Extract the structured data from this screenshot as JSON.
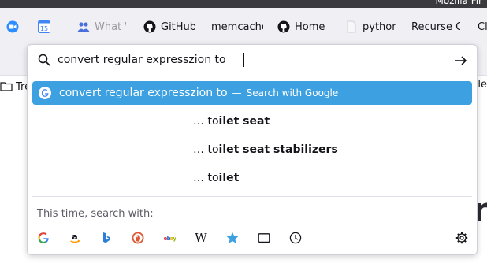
{
  "window": {
    "title_fragment": "Mozilla Fir"
  },
  "bookmarks": {
    "items": [
      {
        "label": "",
        "icon": "zoom-icon"
      },
      {
        "label": "",
        "icon": "calendar-icon",
        "badge": "15"
      },
      {
        "label": "What W",
        "icon": "people-icon"
      },
      {
        "label": "GitHub",
        "icon": "github-icon"
      },
      {
        "label": "memcache",
        "icon": ""
      },
      {
        "label": "Home",
        "icon": "github-icon"
      },
      {
        "label": "python",
        "icon": "page-icon"
      },
      {
        "label": "Recurse C",
        "icon": ""
      },
      {
        "label": "Cl",
        "icon": ""
      }
    ],
    "folder_label": "Tre",
    "right_fragment": "ble"
  },
  "urlbar": {
    "value": "convert regular expresszion to ",
    "go_icon": "arrow-right-icon"
  },
  "results": {
    "selected": {
      "query": "convert regular expresszion to",
      "separator": "—",
      "action": "Search with Google"
    },
    "suggestions": [
      {
        "prefix": "… to",
        "completion": "ilet seat"
      },
      {
        "prefix": "… to",
        "completion": "ilet seat stabilizers"
      },
      {
        "prefix": "… to",
        "completion": "ilet"
      }
    ]
  },
  "oneoffs": {
    "label": "This time, search with:",
    "engines": [
      "google-icon",
      "amazon-icon",
      "bing-icon",
      "duckduckgo-icon",
      "ebay-icon",
      "wikipedia-icon",
      "bookmarks-star-icon",
      "tabs-icon",
      "history-icon"
    ],
    "wiki_glyph": "W"
  },
  "page": {
    "bg_text": "r"
  },
  "colors": {
    "accent": "#3da0e0",
    "star": "#3da0e0"
  }
}
